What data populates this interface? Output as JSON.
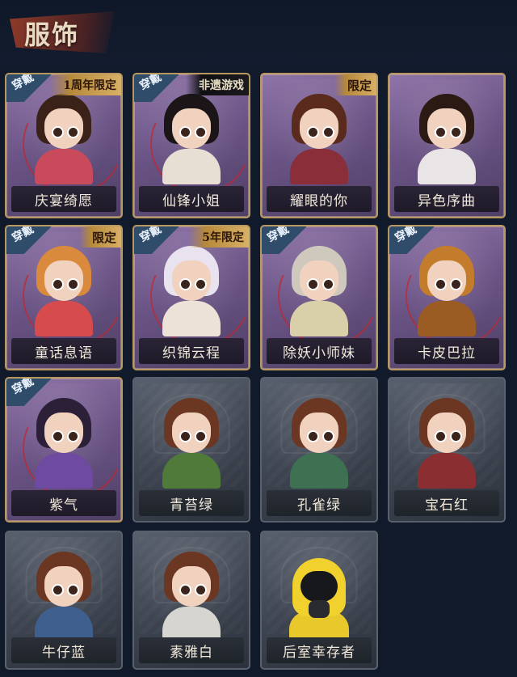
{
  "header": {
    "title": "服饰"
  },
  "badges": {
    "wear": "穿戴"
  },
  "colors": {
    "accent_gold": "#b89860",
    "rare_purple": "#6c5587",
    "common_gray": "#3d4450",
    "wear_blue": "#2f4d6b",
    "ring_red": "#be2832"
  },
  "cards": [
    {
      "name": "庆宴绮愿",
      "rarity": "purple",
      "worn": true,
      "tag": "1周年限定",
      "tag_style": "gold"
    },
    {
      "name": "仙锋小姐",
      "rarity": "purple",
      "worn": true,
      "tag": "非遗游戏",
      "tag_style": "dark"
    },
    {
      "name": "耀眼的你",
      "rarity": "purple",
      "worn": false,
      "tag": "限定",
      "tag_style": "gold"
    },
    {
      "name": "异色序曲",
      "rarity": "purple",
      "worn": false,
      "tag": "",
      "tag_style": ""
    },
    {
      "name": "童话息语",
      "rarity": "purple",
      "worn": true,
      "tag": "限定",
      "tag_style": "gold"
    },
    {
      "name": "织锦云程",
      "rarity": "purple",
      "worn": true,
      "tag": "5年限定",
      "tag_style": "gold"
    },
    {
      "name": "除妖小师妹",
      "rarity": "purple",
      "worn": true,
      "tag": "",
      "tag_style": ""
    },
    {
      "name": "卡皮巴拉",
      "rarity": "purple",
      "worn": true,
      "tag": "",
      "tag_style": ""
    },
    {
      "name": "紫气",
      "rarity": "purple",
      "worn": true,
      "tag": "",
      "tag_style": ""
    },
    {
      "name": "青苔绿",
      "rarity": "gray",
      "worn": false,
      "tag": "",
      "tag_style": ""
    },
    {
      "name": "孔雀绿",
      "rarity": "gray",
      "worn": false,
      "tag": "",
      "tag_style": ""
    },
    {
      "name": "宝石红",
      "rarity": "gray",
      "worn": false,
      "tag": "",
      "tag_style": ""
    },
    {
      "name": "牛仔蓝",
      "rarity": "gray",
      "worn": false,
      "tag": "",
      "tag_style": ""
    },
    {
      "name": "素雅白",
      "rarity": "gray",
      "worn": false,
      "tag": "",
      "tag_style": ""
    },
    {
      "name": "后室幸存者",
      "rarity": "gray",
      "worn": false,
      "tag": "",
      "tag_style": ""
    }
  ]
}
